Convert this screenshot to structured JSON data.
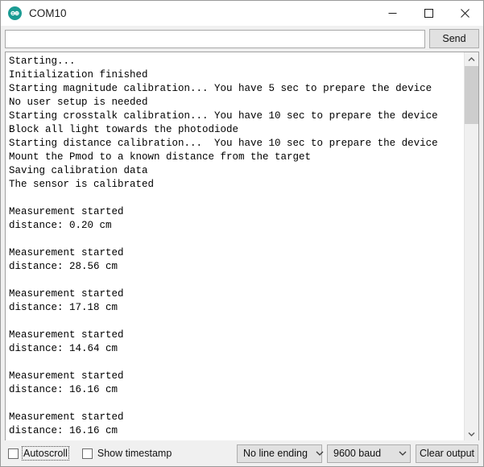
{
  "window": {
    "title": "COM10",
    "app_icon": "arduino-logo-icon",
    "accent_color": "#1a9b93",
    "controls": {
      "minimize": "minimize-icon",
      "maximize": "maximize-icon",
      "close": "close-icon"
    }
  },
  "send_row": {
    "input_value": "",
    "input_placeholder": "",
    "send_label": "Send"
  },
  "console": {
    "lines": [
      "Starting...",
      "Initialization finished",
      "Starting magnitude calibration... You have 5 sec to prepare the device",
      "No user setup is needed",
      "Starting crosstalk calibration... You have 10 sec to prepare the device",
      "Block all light towards the photodiode",
      "Starting distance calibration...  You have 10 sec to prepare the device",
      "Mount the Pmod to a known distance from the target",
      "Saving calibration data",
      "The sensor is calibrated",
      "",
      "Measurement started",
      "distance: 0.20 cm",
      "",
      "Measurement started",
      "distance: 28.56 cm",
      "",
      "Measurement started",
      "distance: 17.18 cm",
      "",
      "Measurement started",
      "distance: 14.64 cm",
      "",
      "Measurement started",
      "distance: 16.16 cm",
      "",
      "Measurement started",
      "distance: 16.16 cm"
    ],
    "measurements": [
      {
        "label": "distance",
        "value": "0.20",
        "unit": "cm"
      },
      {
        "label": "distance",
        "value": "28.56",
        "unit": "cm"
      },
      {
        "label": "distance",
        "value": "17.18",
        "unit": "cm"
      },
      {
        "label": "distance",
        "value": "14.64",
        "unit": "cm"
      },
      {
        "label": "distance",
        "value": "16.16",
        "unit": "cm"
      },
      {
        "label": "distance",
        "value": "16.16",
        "unit": "cm"
      }
    ],
    "scrollbar": {
      "up_icon": "chevron-up-icon",
      "down_icon": "chevron-down-icon",
      "thumb_position": "top"
    }
  },
  "statusbar": {
    "autoscroll": {
      "label": "Autoscroll",
      "checked": false,
      "focused": true
    },
    "show_timestamp": {
      "label": "Show timestamp",
      "checked": false,
      "focused": false
    },
    "line_ending": {
      "selected": "No line ending",
      "caret_icon": "chevron-down-icon"
    },
    "baud_rate": {
      "selected": "9600 baud",
      "caret_icon": "chevron-down-icon"
    },
    "clear_output_label": "Clear output"
  }
}
